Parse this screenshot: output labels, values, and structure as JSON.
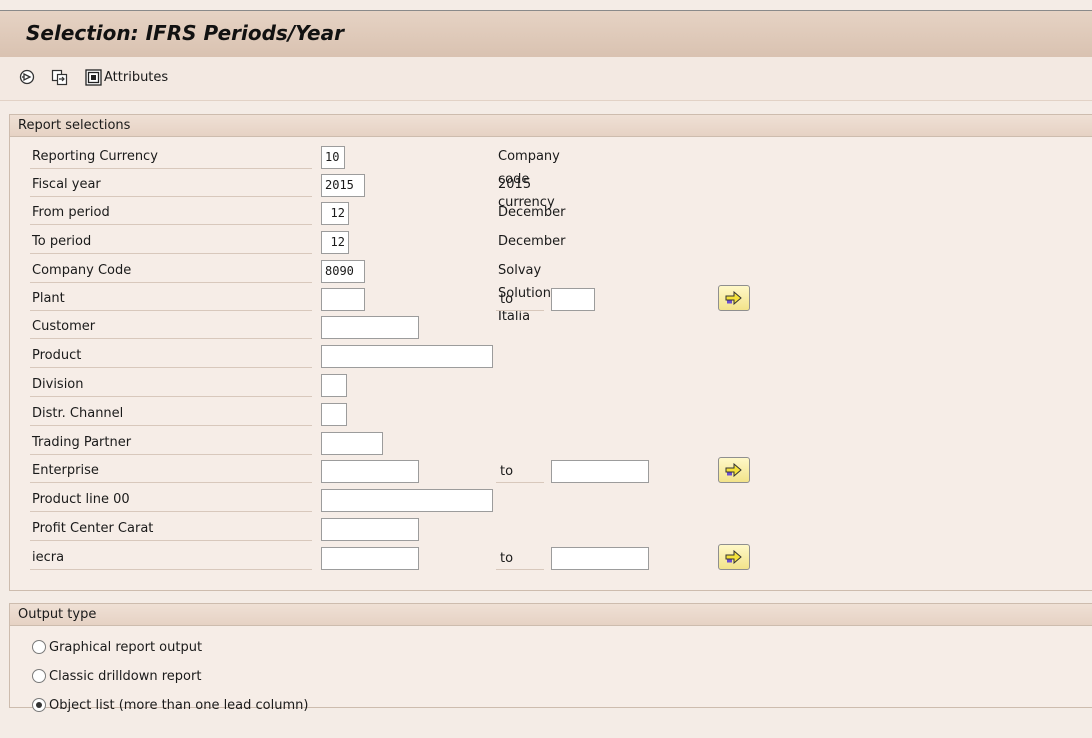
{
  "title": "Selection: IFRS Periods/Year",
  "toolbar": {
    "execute_icon": "execute-icon",
    "variant_icon": "get-variant-icon",
    "attributes_icon": "attributes-icon",
    "attributes_label": "Attributes"
  },
  "report_selections": {
    "header": "Report selections",
    "fields": [
      {
        "label": "Reporting Currency",
        "value": "10",
        "desc": "Company code currency"
      },
      {
        "label": "Fiscal year",
        "value": "2015",
        "desc": "2015"
      },
      {
        "label": "From period",
        "value": "12",
        "desc": "December"
      },
      {
        "label": "To period",
        "value": "12",
        "desc": "December"
      },
      {
        "label": "Company Code",
        "value": "8090",
        "desc": "Solvay Solutions Italia"
      },
      {
        "label": "Plant",
        "value": "",
        "to_label": "to",
        "to_value": ""
      },
      {
        "label": "Customer",
        "value": ""
      },
      {
        "label": "Product",
        "value": ""
      },
      {
        "label": "Division",
        "value": ""
      },
      {
        "label": "Distr. Channel",
        "value": ""
      },
      {
        "label": "Trading Partner",
        "value": ""
      },
      {
        "label": "Enterprise",
        "value": "",
        "to_label": "to",
        "to_value": ""
      },
      {
        "label": "Product line 00",
        "value": ""
      },
      {
        "label": "Profit Center Carat",
        "value": ""
      },
      {
        "label": "iecra",
        "value": "",
        "to_label": "to",
        "to_value": ""
      }
    ],
    "multi_icon": "multiple-selection-arrow-icon"
  },
  "output_type": {
    "header": "Output type",
    "options": [
      {
        "label": "Graphical report output",
        "selected": false
      },
      {
        "label": "Classic drilldown report",
        "selected": false
      },
      {
        "label": "Object list (more than one lead column)",
        "selected": true
      }
    ]
  }
}
